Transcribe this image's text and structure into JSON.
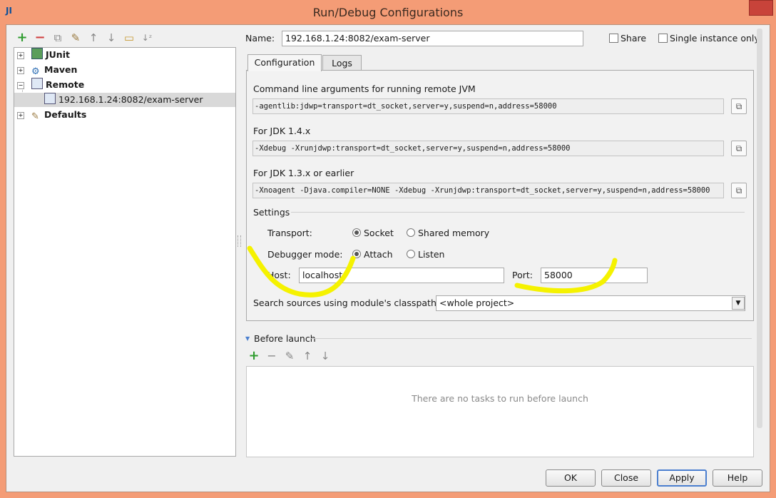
{
  "window": {
    "title": "Run/Debug Configurations",
    "logo_text": "JI"
  },
  "toolbar": {
    "items": [
      {
        "name": "add-icon",
        "glyph": "+"
      },
      {
        "name": "remove-icon",
        "glyph": "−"
      },
      {
        "name": "copy-icon",
        "glyph": "⧉"
      },
      {
        "name": "wrench-icon",
        "glyph": "🔧"
      },
      {
        "name": "move-up-icon",
        "glyph": "↑"
      },
      {
        "name": "move-down-icon",
        "glyph": "↓"
      },
      {
        "name": "folder-icon",
        "glyph": "▭"
      },
      {
        "name": "sort-icon",
        "glyph": "↓ᵃᶻ"
      }
    ]
  },
  "tree": {
    "junit": "JUnit",
    "maven": "Maven",
    "remote": "Remote",
    "remote_child": "192.168.1.24:8082/exam-server",
    "defaults": "Defaults"
  },
  "header": {
    "name_label": "Name:",
    "name_value": "192.168.1.24:8082/exam-server",
    "share_label": "Share",
    "single_instance_label": "Single instance only"
  },
  "tabs": [
    {
      "label": "Configuration"
    },
    {
      "label": "Logs"
    }
  ],
  "config": {
    "cmdline_label": "Command line arguments for running remote JVM",
    "cmdline_value": "-agentlib:jdwp=transport=dt_socket,server=y,suspend=n,address=58000",
    "jdk14_label": "For JDK 1.4.x",
    "jdk14_value": "-Xdebug -Xrunjdwp:transport=dt_socket,server=y,suspend=n,address=58000",
    "jdk13_label": "For JDK 1.3.x or earlier",
    "jdk13_value": "-Xnoagent -Djava.compiler=NONE -Xdebug -Xrunjdwp:transport=dt_socket,server=y,suspend=n,address=58000",
    "settings_label": "Settings",
    "transport_label": "Transport:",
    "transport_socket": "Socket",
    "transport_shared": "Shared memory",
    "debugger_label": "Debugger mode:",
    "debugger_attach": "Attach",
    "debugger_listen": "Listen",
    "host_label": "Host:",
    "host_value": "localhost",
    "port_label": "Port:",
    "port_value": "58000",
    "classpath_label": "Search sources using module's classpath:",
    "classpath_value": "<whole project>"
  },
  "before_launch": {
    "label": "Before launch",
    "empty_text": "There are no tasks to run before launch"
  },
  "buttons": {
    "ok": "OK",
    "close": "Close",
    "apply": "Apply",
    "help": "Help"
  },
  "colors": {
    "frame": "#f49c76",
    "highlight_marker": "#f5f200",
    "accent": "#4b7fcf"
  }
}
